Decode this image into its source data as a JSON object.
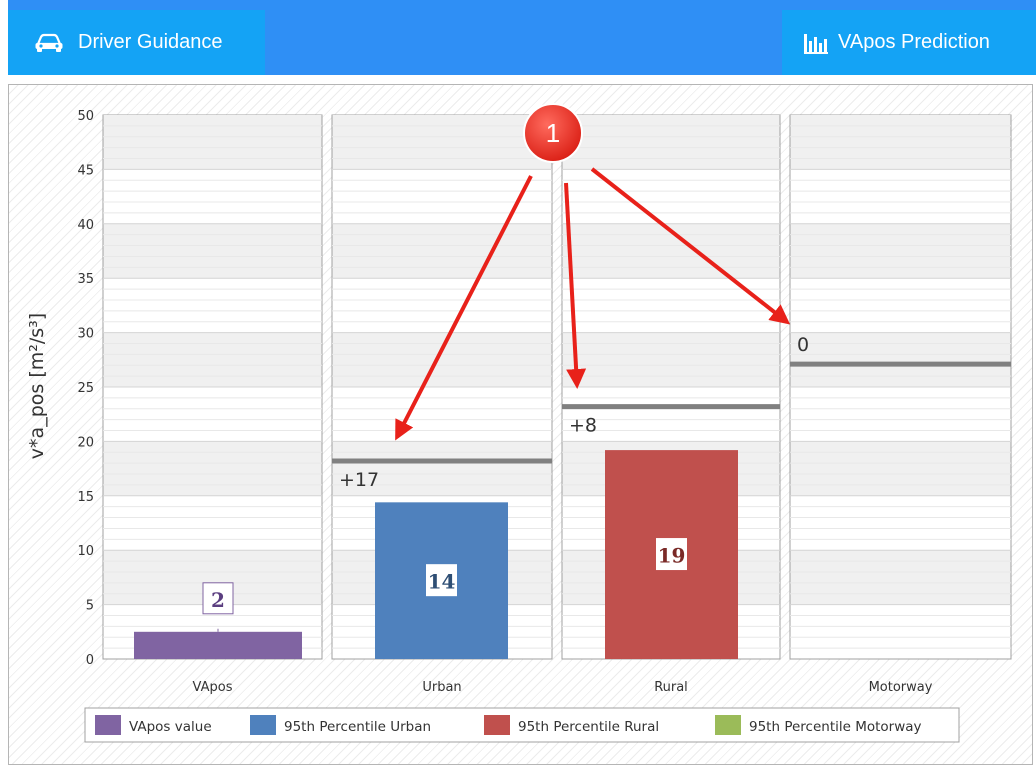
{
  "header": {
    "left_tab_label": "Driver Guidance",
    "left_tab_icon": "car-icon",
    "right_tab_label": "VApos Prediction",
    "right_tab_icon": "bar-chart-icon"
  },
  "colors": {
    "header_bg": "#2f8ff5",
    "tab_bg": "#14a3f5",
    "vapos": "#8064a2",
    "urban": "#4f81bd",
    "rural": "#c0504d",
    "motorway": "#9bbb59",
    "threshold": "#808080",
    "annotation": "#e8211a"
  },
  "chart_data": {
    "type": "bar",
    "ylabel": "v*a_pos [m²/s³]",
    "ylim": [
      0,
      50
    ],
    "y_ticks": [
      "0",
      "5",
      "10",
      "15",
      "20",
      "25",
      "30",
      "35",
      "40",
      "45",
      "50"
    ],
    "panes": [
      {
        "category": "VApos",
        "series": "VApos value",
        "value": 2.5,
        "value_label": "2",
        "threshold": null,
        "threshold_label": ""
      },
      {
        "category": "Urban",
        "series": "95th Percentile Urban",
        "value": 14.4,
        "value_label": "14",
        "threshold": 18.2,
        "threshold_label": "+17"
      },
      {
        "category": "Rural",
        "series": "95th Percentile Rural",
        "value": 19.2,
        "value_label": "19",
        "threshold": 23.2,
        "threshold_label": "+8"
      },
      {
        "category": "Motorway",
        "series": "95th Percentile Motorway",
        "value": 0,
        "value_label": "",
        "threshold": 27.1,
        "threshold_label": "0"
      }
    ],
    "legend": [
      "VApos value",
      "95th Percentile Urban",
      "95th Percentile Rural",
      "95th Percentile Motorway"
    ],
    "legend_position": "bottom",
    "grid": true,
    "annotation": {
      "badge": "1",
      "arrows_to": [
        "Urban",
        "Rural",
        "Motorway"
      ]
    }
  }
}
